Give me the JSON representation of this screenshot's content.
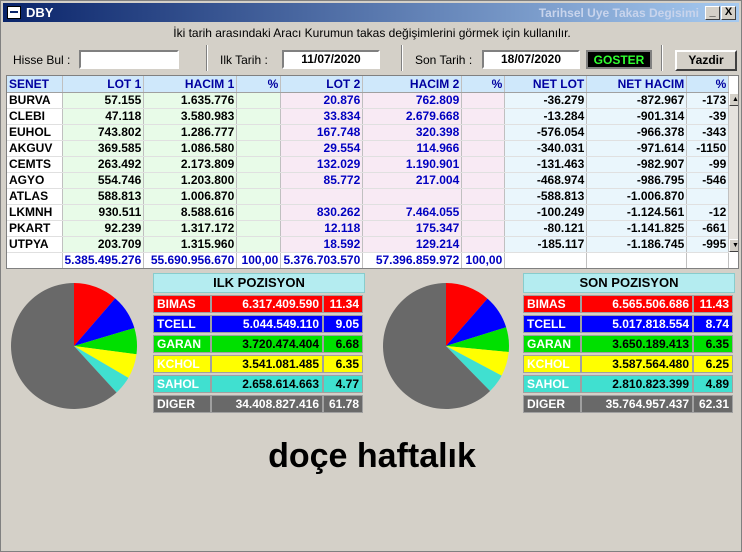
{
  "window": {
    "title": "DBY",
    "title_right": "Tarihsel Uye Takas Degisimi",
    "min_label": "_",
    "close_label": "X"
  },
  "hint": "İki tarih arasındaki  Aracı Kurumun takas değişimlerini görmek için kullanılır.",
  "search": {
    "label": "Hisse Bul :",
    "value": ""
  },
  "start_date": {
    "label": "Ilk Tarih :",
    "value": "11/07/2020"
  },
  "end_date": {
    "label": "Son Tarih :",
    "value": "18/07/2020"
  },
  "show_button": "GOSTER",
  "print_button": "Yazdir",
  "table": {
    "headers": [
      "SENET",
      "LOT 1",
      "HACIM 1",
      "%",
      "LOT 2",
      "HACIM 2",
      "%",
      "NET LOT",
      "NET HACIM",
      "%"
    ],
    "rows": [
      [
        "BURVA",
        "57.155",
        "1.635.776",
        "",
        "20.876",
        "762.809",
        "",
        "-36.279",
        "-872.967",
        "-173"
      ],
      [
        "CLEBI",
        "47.118",
        "3.580.983",
        "",
        "33.834",
        "2.679.668",
        "",
        "-13.284",
        "-901.314",
        "-39"
      ],
      [
        "EUHOL",
        "743.802",
        "1.286.777",
        "",
        "167.748",
        "320.398",
        "",
        "-576.054",
        "-966.378",
        "-343"
      ],
      [
        "AKGUV",
        "369.585",
        "1.086.580",
        "",
        "29.554",
        "114.966",
        "",
        "-340.031",
        "-971.614",
        "-1150"
      ],
      [
        "CEMTS",
        "263.492",
        "2.173.809",
        "",
        "132.029",
        "1.190.901",
        "",
        "-131.463",
        "-982.907",
        "-99"
      ],
      [
        "AGYO",
        "554.746",
        "1.203.800",
        "",
        "85.772",
        "217.004",
        "",
        "-468.974",
        "-986.795",
        "-546"
      ],
      [
        "ATLAS",
        "588.813",
        "1.006.870",
        "",
        "",
        "",
        "",
        "-588.813",
        "-1.006.870",
        ""
      ],
      [
        "LKMNH",
        "930.511",
        "8.588.616",
        "",
        "830.262",
        "7.464.055",
        "",
        "-100.249",
        "-1.124.561",
        "-12"
      ],
      [
        "PKART",
        "92.239",
        "1.317.172",
        "",
        "12.118",
        "175.347",
        "",
        "-80.121",
        "-1.141.825",
        "-661"
      ],
      [
        "UTPYA",
        "203.709",
        "1.315.960",
        "",
        "18.592",
        "129.214",
        "",
        "-185.117",
        "-1.186.745",
        "-995"
      ]
    ],
    "totals": [
      "",
      "5.385.495.276",
      "55.690.956.670",
      "100,00",
      "5.376.703.570",
      "57.396.859.972",
      "100,00",
      "",
      "",
      ""
    ]
  },
  "first_position": {
    "title": "ILK POZISYON",
    "rows": [
      {
        "name": "BIMAS",
        "value": "6.317.409.590",
        "pct": "11.34",
        "color": "#ff0000"
      },
      {
        "name": "TCELL",
        "value": "5.044.549.110",
        "pct": "9.05",
        "color": "#0000ff"
      },
      {
        "name": "GARAN",
        "value": "3.720.474.404",
        "pct": "6.68",
        "color": "#00e000"
      },
      {
        "name": "KCHOL",
        "value": "3.541.081.485",
        "pct": "6.35",
        "color": "#ffff00"
      },
      {
        "name": "SAHOL",
        "value": "2.658.614.663",
        "pct": "4.77",
        "color": "#40e0d0"
      },
      {
        "name": "DIGER",
        "value": "34.408.827.416",
        "pct": "61.78",
        "color": "#696969"
      }
    ]
  },
  "last_position": {
    "title": "SON POZISYON",
    "rows": [
      {
        "name": "BIMAS",
        "value": "6.565.506.686",
        "pct": "11.43",
        "color": "#ff0000"
      },
      {
        "name": "TCELL",
        "value": "5.017.818.554",
        "pct": "8.74",
        "color": "#0000ff"
      },
      {
        "name": "GARAN",
        "value": "3.650.189.413",
        "pct": "6.35",
        "color": "#00e000"
      },
      {
        "name": "KCHOL",
        "value": "3.587.564.480",
        "pct": "6.25",
        "color": "#ffff00"
      },
      {
        "name": "SAHOL",
        "value": "2.810.823.399",
        "pct": "4.89",
        "color": "#40e0d0"
      },
      {
        "name": "DIGER",
        "value": "35.764.957.437",
        "pct": "62.31",
        "color": "#696969"
      }
    ]
  },
  "caption": "doçe haftalık"
}
